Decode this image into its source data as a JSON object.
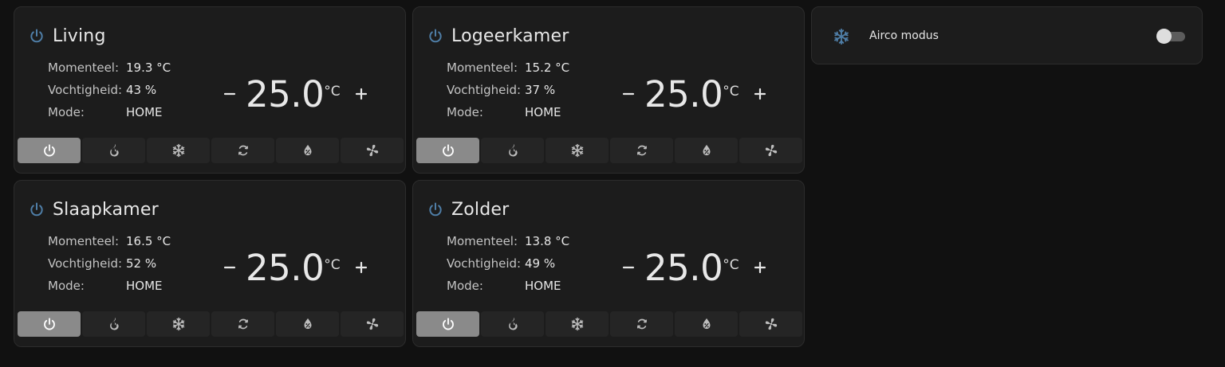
{
  "labels": {
    "current": "Momenteel:",
    "humidity": "Vochtigheid:",
    "mode": "Mode:"
  },
  "units": {
    "temp": "°C"
  },
  "adjust": {
    "minus": "–",
    "plus": "+"
  },
  "thermostats": [
    {
      "name": "Living",
      "current": "19.3 °C",
      "humidity": "43 %",
      "mode": "HOME",
      "setpoint": "25.0",
      "active_mode": "off"
    },
    {
      "name": "Logeerkamer",
      "current": "15.2 °C",
      "humidity": "37 %",
      "mode": "HOME",
      "setpoint": "25.0",
      "active_mode": "off"
    },
    {
      "name": "Slaapkamer",
      "current": "16.5 °C",
      "humidity": "52 %",
      "mode": "HOME",
      "setpoint": "25.0",
      "active_mode": "off"
    },
    {
      "name": "Zolder",
      "current": "13.8 °C",
      "humidity": "49 %",
      "mode": "HOME",
      "setpoint": "25.0",
      "active_mode": "off"
    }
  ],
  "hvac_modes": [
    "power-icon",
    "flame-icon",
    "snowflake-icon",
    "autorenew-icon",
    "water-percent-icon",
    "fan-icon"
  ],
  "airco": {
    "label": "Airco modus",
    "icon": "snowflake-icon",
    "on": false
  },
  "colors": {
    "accent": "#4f7ea7",
    "active_mode_bg": "#8a8a8a",
    "card_bg": "#1c1c1c",
    "page_bg": "#111111"
  }
}
